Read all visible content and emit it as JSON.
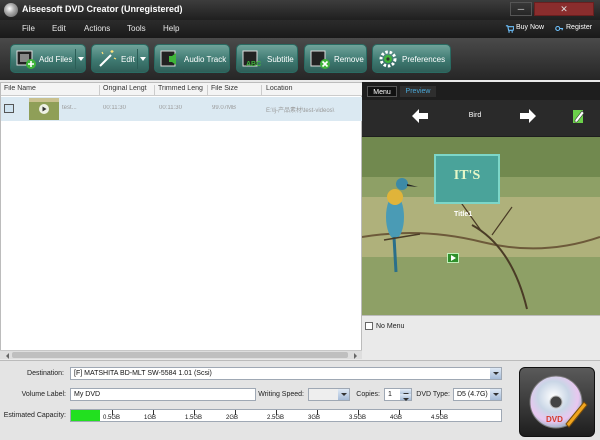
{
  "window": {
    "title": "Aiseesoft DVD Creator (Unregistered)",
    "minimize": "─",
    "close": "✕"
  },
  "menu": {
    "items": [
      "File",
      "Edit",
      "Actions",
      "Tools",
      "Help"
    ],
    "buy_now": "Buy Now",
    "register": "Register"
  },
  "toolbar": {
    "add_files": "Add Files",
    "edit": "Edit",
    "audio_track": "Audio Track",
    "subtitle": "Subtitle",
    "remove": "Remove",
    "preferences": "Preferences"
  },
  "file_list": {
    "columns": [
      "File Name",
      "Original Lengt",
      "Trimmed Leng",
      "File Size",
      "Location"
    ],
    "rows": [
      {
        "name": "test...",
        "original": "00:11:30",
        "trimmed": "00:11:30",
        "size": "99.07MB",
        "location": "E:\\lj-产品素材\\test-videos\\"
      }
    ]
  },
  "preview": {
    "tabs": [
      "Menu",
      "Preview"
    ],
    "theme": "Bird",
    "title_label": "Title1",
    "thumb_text": "IT'S",
    "no_menu": "No Menu"
  },
  "settings": {
    "destination_label": "Destination:",
    "destination_value": "[F] MATSHITA BD-MLT SW-5584 1.01 (Scsi)",
    "volume_label": "Volume Label:",
    "volume_value": "My DVD",
    "writing_speed_label": "Writing Speed:",
    "writing_speed_value": "",
    "copies_label": "Copies:",
    "copies_value": "1",
    "dvd_type_label": "DVD Type:",
    "dvd_type_value": "D5 (4.7G)",
    "capacity_label": "Estimated Capacity:",
    "capacity_ticks": [
      "0.5GB",
      "1GB",
      "1.5GB",
      "2GB",
      "2.5GB",
      "3GB",
      "3.5GB",
      "4GB",
      "4.5GB"
    ],
    "capacity_used_gb": 0.35
  },
  "burn": {
    "disc_text": "DVD"
  },
  "colors": {
    "accent": "#3f7a72",
    "capacity_fill": "#22e01f",
    "link_tab": "#4aa8d8"
  }
}
